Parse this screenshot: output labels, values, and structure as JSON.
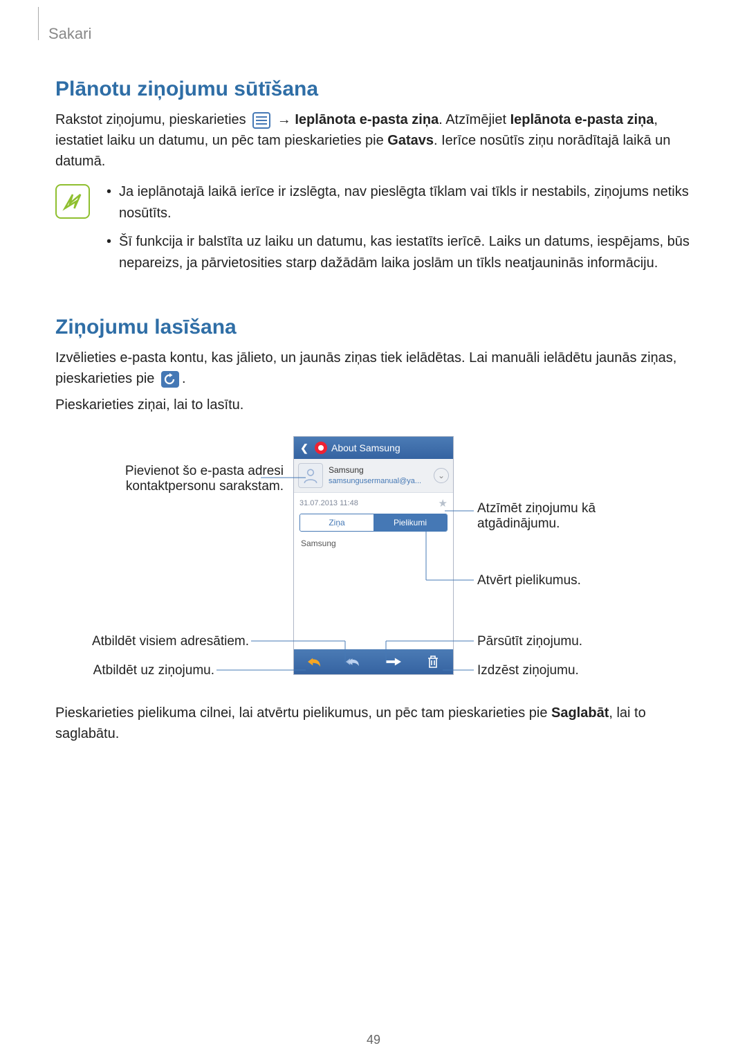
{
  "breadcrumb": "Sakari",
  "section1_title": "Plānotu ziņojumu sūtīšana",
  "para1_a": "Rakstot ziņojumu, pieskarieties ",
  "para1_arrow": " → ",
  "para1_bold1": "Ieplānota e-pasta ziņa",
  "para1_b": ". Atzīmējiet ",
  "para1_bold2": "Ieplānota e-pasta ziņa",
  "para1_c": ", iestatiet laiku un datumu, un pēc tam pieskarieties pie ",
  "para1_bold3": "Gatavs",
  "para1_d": ". Ierīce nosūtīs ziņu norādītajā laikā un datumā.",
  "note_li1": "Ja ieplānotajā laikā ierīce ir izslēgta, nav pieslēgta tīklam vai tīkls ir nestabils, ziņojums netiks nosūtīts.",
  "note_li2": "Šī funkcija ir balstīta uz laiku un datumu, kas iestatīts ierīcē. Laiks un datums, iespējams, būs nepareizs, ja pārvietosities starp dažādām laika joslām un tīkls neatjauninās informāciju.",
  "section2_title": "Ziņojumu lasīšana",
  "para2_a": "Izvēlieties e-pasta kontu, kas jālieto, un jaunās ziņas tiek ielādētas. Lai manuāli ielādētu jaunās ziņas, pieskarieties pie ",
  "para2_b": ".",
  "para3": "Pieskarieties ziņai, lai to lasītu.",
  "phone": {
    "header_title": "About Samsung",
    "sender_name": "Samsung",
    "sender_email": "samsungusermanual@ya...",
    "timestamp": "31.07.2013  11:48",
    "tab_message": "Ziņa",
    "tab_attach": "Pielikumi",
    "body_text": "Samsung"
  },
  "call_contact1": "Pievienot šo e-pasta adresi",
  "call_contact2": "kontaktpersonu sarakstam.",
  "call_replyall": "Atbildēt visiem adresātiem.",
  "call_reply": "Atbildēt uz ziņojumu.",
  "call_flag1": "Atzīmēt ziņojumu kā",
  "call_flag2": "atgādinājumu.",
  "call_openattach": "Atvērt pielikumus.",
  "call_forward": "Pārsūtīt ziņojumu.",
  "call_delete": "Izdzēst ziņojumu.",
  "para4_a": "Pieskarieties pielikuma cilnei, lai atvērtu pielikumus, un pēc tam pieskarieties pie ",
  "para4_bold": "Saglabāt",
  "para4_b": ", lai to saglabātu.",
  "page_number": "49"
}
